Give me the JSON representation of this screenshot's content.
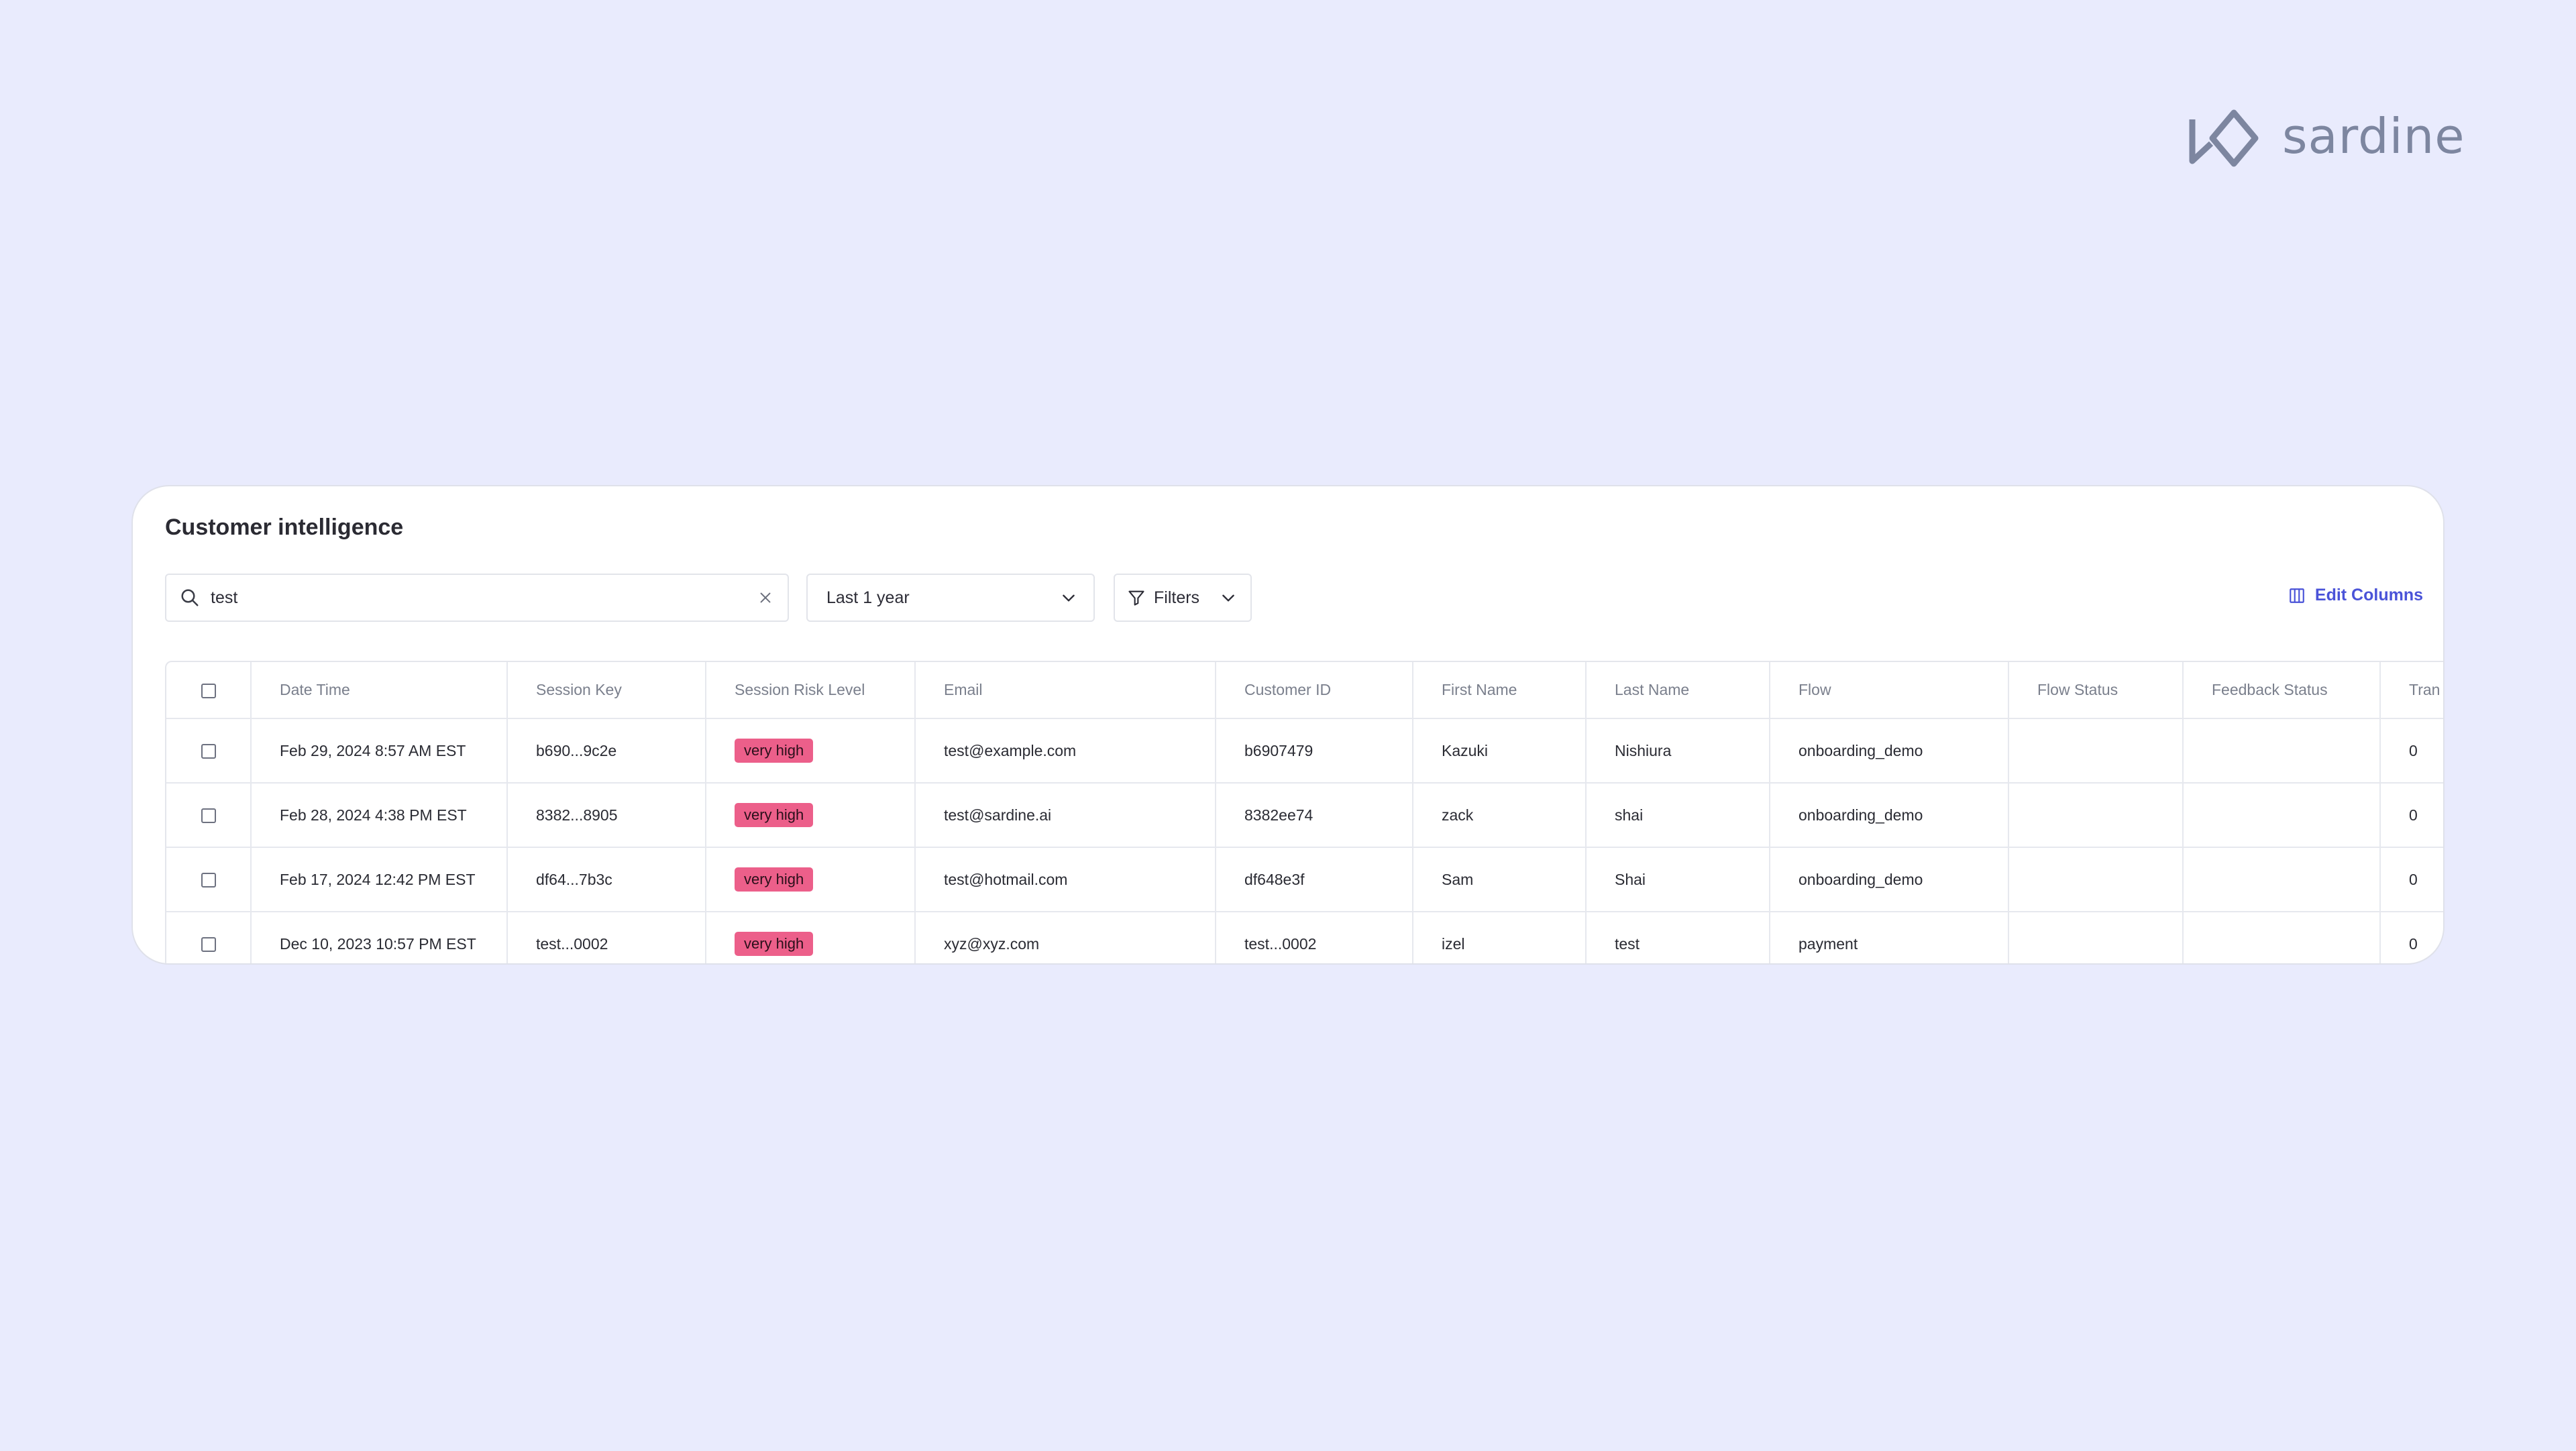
{
  "brand": {
    "name": "sardine",
    "color": "#7d86a0"
  },
  "page": {
    "title": "Customer intelligence"
  },
  "toolbar": {
    "search_value": "test",
    "date_range": "Last 1 year",
    "filters_label": "Filters",
    "edit_columns_label": "Edit Columns",
    "accent_color": "#4a53d8"
  },
  "table": {
    "columns": [
      "Date Time",
      "Session Key",
      "Session Risk Level",
      "Email",
      "Customer ID",
      "First Name",
      "Last Name",
      "Flow",
      "Flow Status",
      "Feedback Status",
      "Tran"
    ],
    "rows": [
      {
        "date_time": "Feb 29, 2024 8:57 AM EST",
        "session_key": "b690...9c2e",
        "risk": "very high",
        "email": "test@example.com",
        "customer_id": "b6907479",
        "first_name": "Kazuki",
        "last_name": "Nishiura",
        "flow": "onboarding_demo",
        "flow_status": "",
        "feedback_status": "",
        "tran": "0"
      },
      {
        "date_time": "Feb 28, 2024 4:38 PM EST",
        "session_key": "8382...8905",
        "risk": "very high",
        "email": "test@sardine.ai",
        "customer_id": "8382ee74",
        "first_name": "zack",
        "last_name": "shai",
        "flow": "onboarding_demo",
        "flow_status": "",
        "feedback_status": "",
        "tran": "0"
      },
      {
        "date_time": "Feb 17, 2024 12:42 PM EST",
        "session_key": "df64...7b3c",
        "risk": "very high",
        "email": "test@hotmail.com",
        "customer_id": "df648e3f",
        "first_name": "Sam",
        "last_name": "Shai",
        "flow": "onboarding_demo",
        "flow_status": "",
        "feedback_status": "",
        "tran": "0"
      },
      {
        "date_time": "Dec 10, 2023 10:57 PM EST",
        "session_key": "test...0002",
        "risk": "very high",
        "email": "xyz@xyz.com",
        "customer_id": "test...0002",
        "first_name": "izel",
        "last_name": "test",
        "flow": "payment",
        "flow_status": "",
        "feedback_status": "",
        "tran": "0"
      }
    ],
    "risk_badge_color": "#ec5f8a"
  }
}
